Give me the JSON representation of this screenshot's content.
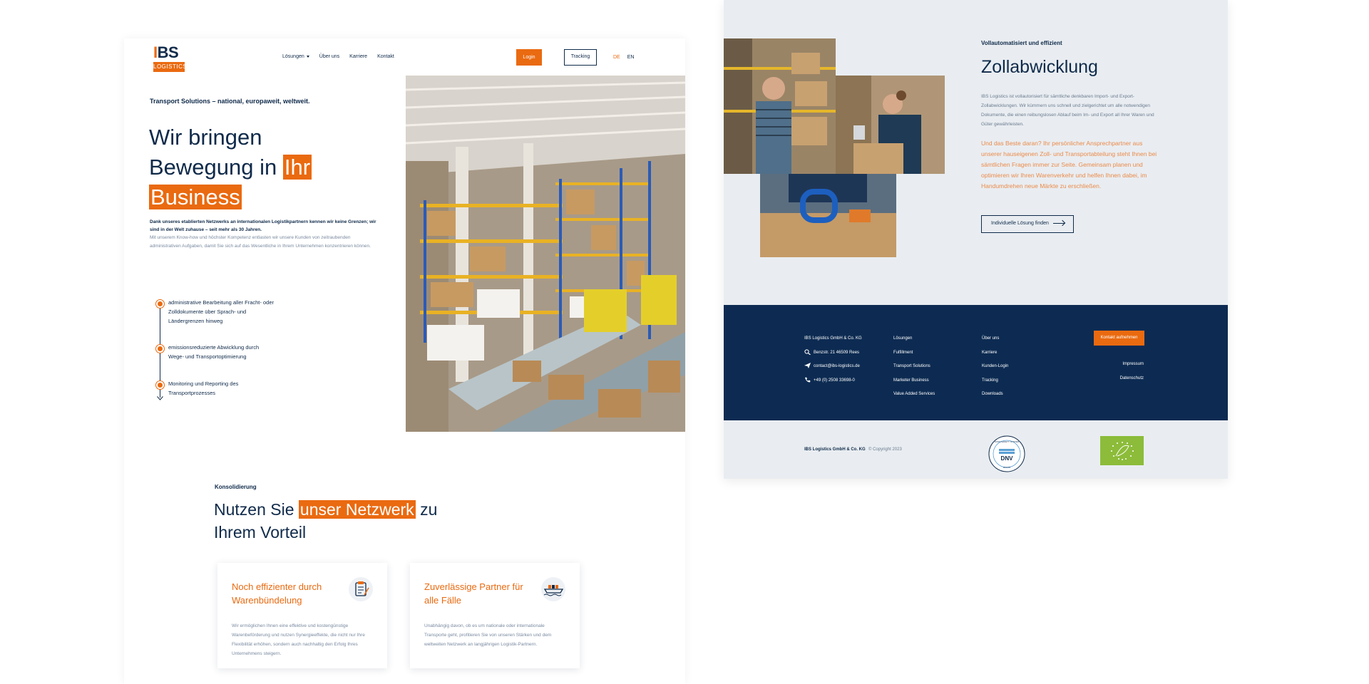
{
  "header": {
    "logo_main": "IBS",
    "logo_sub": "LOGISTICS",
    "nav": [
      "Lösungen",
      "Über uns",
      "Karriere",
      "Kontakt"
    ],
    "login_label": "Login",
    "tracking_label": "Tracking",
    "lang_de": "DE",
    "lang_en": "EN"
  },
  "hero": {
    "kicker": "Transport Solutions – national, europaweit, weltweit.",
    "title_1": "Wir bringen",
    "title_2": "Bewegung in ",
    "title_hl_1": "Ihr",
    "title_hl_2": "Business",
    "lead": "Dank unseres etablierten Netzwerks an internationalen Logistikpartnern kennen wir keine Grenzen; wir sind in der Welt zuhause – seit mehr als 30 Jahren.",
    "body": "Mit unserem Know-how und höchster Kompetenz entlasten wir unsere Kunden von zeitraubenden administrativen Aufgaben, damit Sie sich auf das Wesentliche in Ihrem Unternehmen konzentrieren können."
  },
  "features": [
    "administrative Bearbeitung aller Fracht- oder Zolldokumente über Sprach- und Ländergrenzen hinweg",
    "emissionsreduzierte Abwicklung durch Wege- und Transportoptimierung",
    "Monitoring und Reporting des Transportprozesses"
  ],
  "section2": {
    "kicker": "Konsolidierung",
    "title_1": "Nutzen Sie ",
    "title_hl": "unser Netzwerk",
    "title_2": " zu Ihrem Vorteil"
  },
  "cards": [
    {
      "title": "Noch effizienter durch Warenbündelung",
      "icon": "clipboard-icon",
      "body": "Wir ermöglichen Ihnen eine effektive und kostengünstige Warenbeförderung und nutzen Synergieeffekte, die nicht nur Ihre Flexibilität erhöhen, sondern auch nachhaltig den Erfolg Ihres Unternehmens steigern."
    },
    {
      "title": "Zuverlässige Partner für alle Fälle",
      "icon": "ship-icon",
      "body": "Unabhängig davon, ob es um nationale oder internationale Transporte geht, profitieren Sie von unseren Stärken und dem weltweiten Netzwerk an langjährigen Logistik-Partnern."
    }
  ],
  "customs": {
    "kicker": "Vollautomatisiert und effizient",
    "title": "Zollabwicklung",
    "body": "IBS Logistics ist vollautorisiert für sämtliche denkbaren Import- und Export-Zollabwicklungen. Wir kümmern uns schnell und zielgerichtet um alle notwendigen Dokumente, die einen reibungslosen Ablauf beim Im- und Export all Ihrer Waren und Güter gewährleisten.",
    "highlight": "Und das Beste daran? Ihr persönlicher Ansprechpartner aus unserer hauseigenen Zoll- und Transportabteilung steht Ihnen bei sämtlichen Fragen immer zur Seite. Gemeinsam planen und optimieren wir Ihren Warenverkehr und helfen Ihnen dabei, im Handumdrehen neue Märkte zu erschließen.",
    "button": "Individuelle Lösung finden"
  },
  "footer": {
    "company": "IBS Logistics GmbH & Co. KG",
    "address": "Benzstr. 21 46509 Rees",
    "email": "contact@ibs-logistics.de",
    "phone": "+49 (0) 2508 33698-0",
    "col2": [
      "Lösungen",
      "Fulfillment",
      "Transport Solutions",
      "Marketer Business",
      "Value Added Services"
    ],
    "col3": [
      "Über uns",
      "Karriere",
      "Kunden-Login",
      "Tracking",
      "Downloads"
    ],
    "cta": "Kontakt aufnehmen",
    "impressum": "Impressum",
    "datenschutz": "Datenschutz"
  },
  "subfooter": {
    "company": "IBS Logistics GmbH & Co. KG",
    "copyright": "© Copyright 2023",
    "cert_label": "DNV",
    "cert_ring": "FOOD SAFETY SYSTEM",
    "cert_bottom": "HACCP"
  },
  "colors": {
    "accent": "#ea6a10",
    "navy": "#0d2b52",
    "light_bg": "#e9edf1"
  }
}
